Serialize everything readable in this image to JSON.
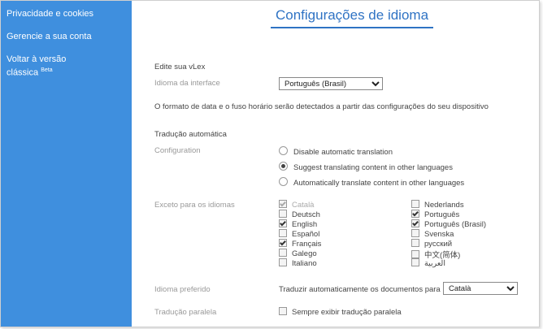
{
  "sidebar": {
    "privacy": "Privacidade e cookies",
    "account": "Gerencie a sua conta",
    "classic_line1": "Voltar à versão",
    "classic_line2": "clássica",
    "classic_badge": "Beta"
  },
  "page_title": "Configurações de idioma",
  "edit_heading": "Edite sua vLex",
  "interface_label": "Idioma da interface",
  "interface_value": "Português (Brasil)",
  "date_note": "O formato de data e o fuso horário serão detectados a partir das configurações do seu dispositivo",
  "auto_heading": "Tradução automática",
  "config_label": "Configuration",
  "radios": [
    {
      "label": "Disable automatic translation",
      "selected": false
    },
    {
      "label": "Suggest translating content in other languages",
      "selected": true
    },
    {
      "label": "Automatically translate content in other languages",
      "selected": false
    }
  ],
  "except_label": "Exceto para os idiomas",
  "languages_left": [
    {
      "label": "Català",
      "checked": true,
      "disabled": true
    },
    {
      "label": "Deutsch",
      "checked": false
    },
    {
      "label": "English",
      "checked": true
    },
    {
      "label": "Español",
      "checked": false
    },
    {
      "label": "Français",
      "checked": true
    },
    {
      "label": "Galego",
      "checked": false
    },
    {
      "label": "Italiano",
      "checked": false
    }
  ],
  "languages_right": [
    {
      "label": "Nederlands",
      "checked": false
    },
    {
      "label": "Português",
      "checked": true
    },
    {
      "label": "Português (Brasil)",
      "checked": true
    },
    {
      "label": "Svenska",
      "checked": false
    },
    {
      "label": "русский",
      "checked": false
    },
    {
      "label": "中文(简体)",
      "checked": false
    },
    {
      "label": "العربية",
      "checked": false
    }
  ],
  "preferred_label": "Idioma preferido",
  "preferred_text": "Traduzir automaticamente os documentos para",
  "preferred_value": "Català",
  "parallel_label": "Tradução paralela",
  "parallel_text": "Sempre exibir tradução paralela",
  "colors": {
    "sidebar": "#3f8fde",
    "title": "#2f73c4"
  }
}
